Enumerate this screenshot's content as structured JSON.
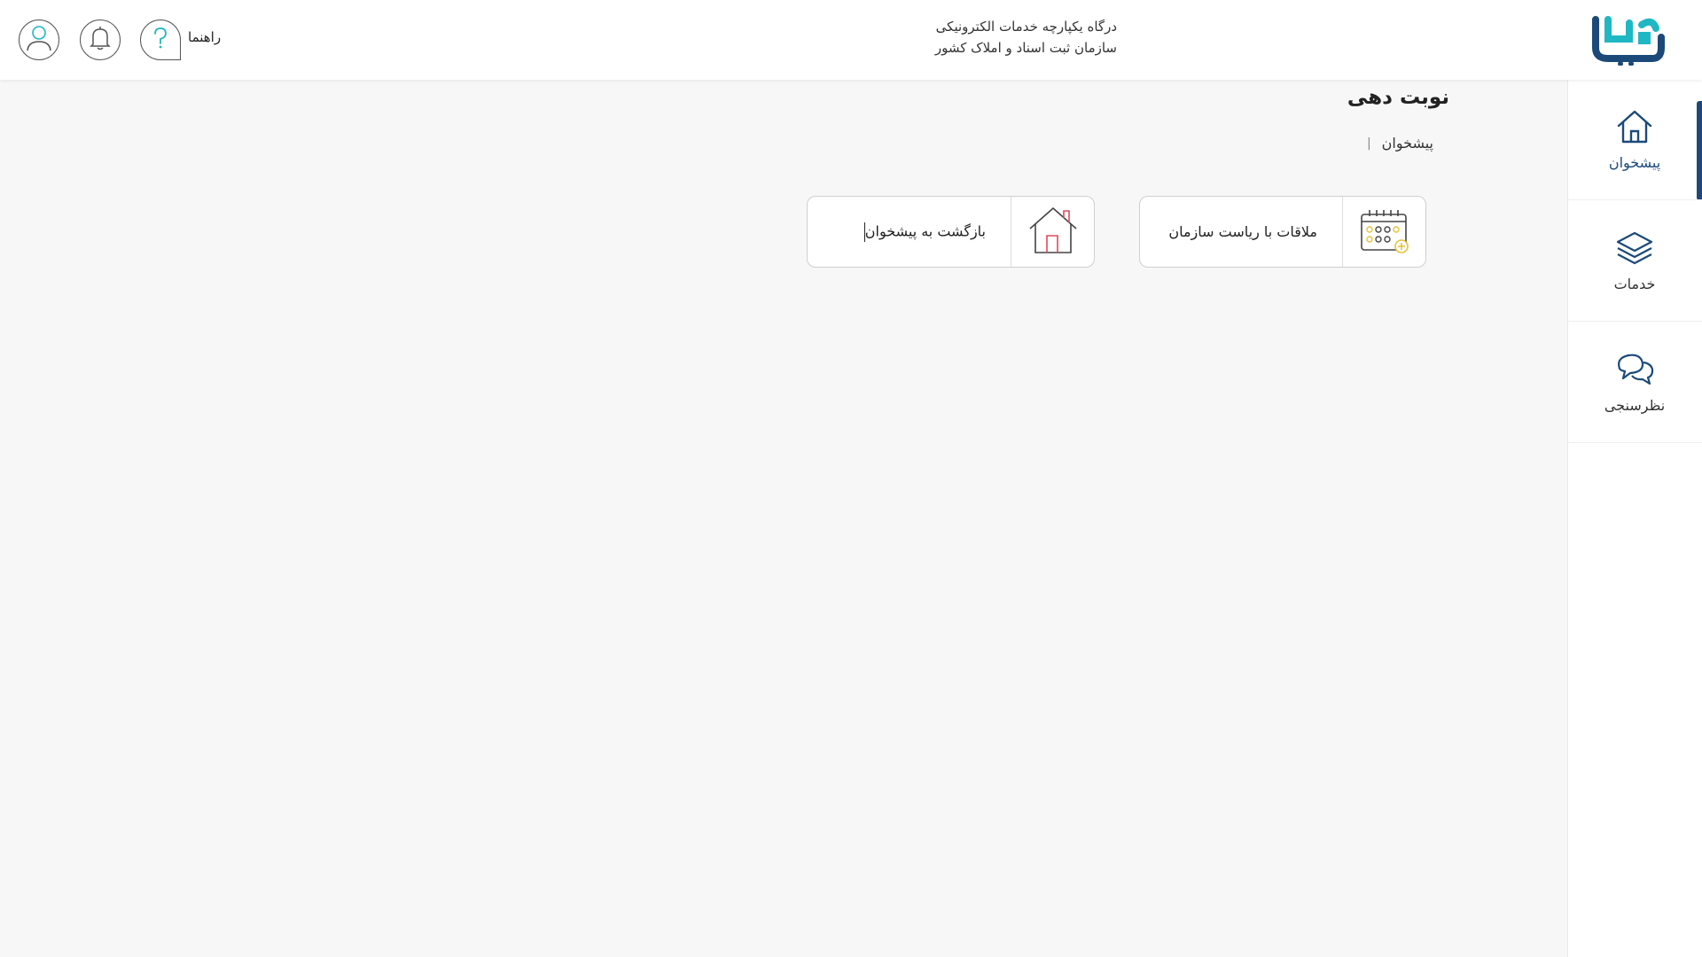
{
  "header": {
    "title_line1": "درگاه یکپارچه خدمات الکترونیکی",
    "title_line2": "سازمان ثبت اسناد و املاک کشور",
    "help_label": "راهنما",
    "logo_text": "ثبت من"
  },
  "sidebar": {
    "items": [
      {
        "label": "پیشخوان",
        "icon": "home-icon",
        "active": true
      },
      {
        "label": "خدمات",
        "icon": "layers-icon",
        "active": false
      },
      {
        "label": "نظرسنجی",
        "icon": "chat-bubbles-icon",
        "active": false
      }
    ]
  },
  "main": {
    "page_title": "نوبت دهی",
    "breadcrumb": [
      "پیشخوان"
    ],
    "cards": [
      {
        "label": "ملاقات با ریاست سازمان",
        "icon": "calendar-add-icon"
      },
      {
        "label": "بازگشت به پیشخوان",
        "icon": "house-icon"
      }
    ]
  },
  "colors": {
    "brand_teal": "#1fb7c4",
    "brand_navy": "#1b4a7a",
    "background": "#f7f7f7",
    "accent_red": "#e04a5a",
    "accent_yellow": "#e8c23a"
  }
}
